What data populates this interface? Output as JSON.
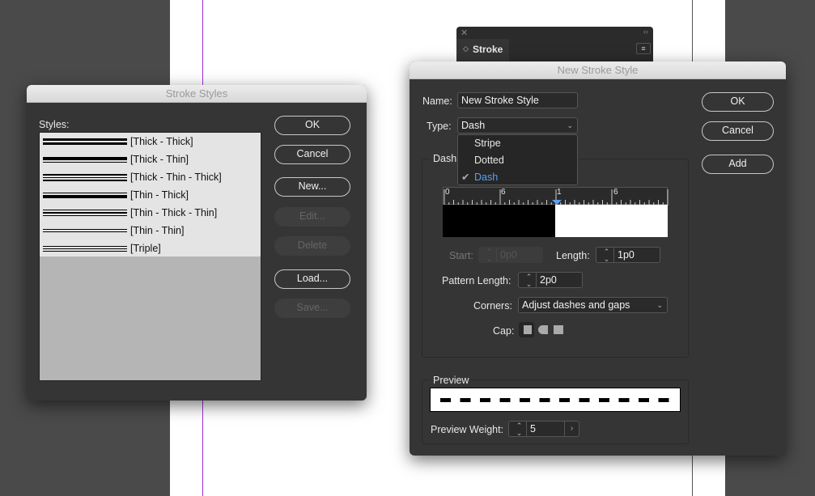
{
  "stroke_panel": {
    "title": "Stroke",
    "close_icon": "close-icon",
    "collapse_icon": "double-chevron-left-icon",
    "menu_icon": "hamburger-menu-icon"
  },
  "stroke_styles": {
    "title": "Stroke Styles",
    "styles_label": "Styles:",
    "items": [
      {
        "label": "[Thick - Thick]",
        "lines": [
          3,
          3
        ]
      },
      {
        "label": "[Thick - Thin]",
        "lines": [
          4,
          1
        ]
      },
      {
        "label": "[Thick - Thin - Thick]",
        "lines": [
          2,
          1,
          2
        ]
      },
      {
        "label": "[Thin - Thick]",
        "lines": [
          1,
          4
        ]
      },
      {
        "label": "[Thin - Thick - Thin]",
        "lines": [
          1,
          2,
          1
        ]
      },
      {
        "label": "[Thin - Thin]",
        "lines": [
          1,
          1
        ]
      },
      {
        "label": "[Triple]",
        "lines": [
          1,
          1,
          1
        ]
      }
    ],
    "buttons": {
      "ok": "OK",
      "cancel": "Cancel",
      "new": "New...",
      "edit": "Edit...",
      "delete": "Delete",
      "load": "Load...",
      "save": "Save..."
    }
  },
  "new_stroke_style": {
    "title": "New Stroke Style",
    "name_label": "Name:",
    "name_value": "New Stroke Style",
    "type_label": "Type:",
    "type_value": "Dash",
    "type_options": [
      "Stripe",
      "Dotted",
      "Dash"
    ],
    "type_selected": "Dash",
    "dash_group": "Dash",
    "ruler_labels": [
      "0",
      "6",
      "1",
      "6"
    ],
    "start_label": "Start:",
    "start_value": "0p0",
    "length_label": "Length:",
    "length_value": "1p0",
    "pattern_length_label": "Pattern Length:",
    "pattern_length_value": "2p0",
    "corners_label": "Corners:",
    "corners_value": "Adjust dashes and gaps",
    "cap_label": "Cap:",
    "cap_icons": [
      "butt-cap-icon",
      "round-cap-icon",
      "projecting-cap-icon"
    ],
    "preview_group": "Preview",
    "preview_weight_label": "Preview Weight:",
    "preview_weight_value": "5",
    "buttons": {
      "ok": "OK",
      "cancel": "Cancel",
      "add": "Add"
    },
    "accent": "#5aa0f0"
  }
}
